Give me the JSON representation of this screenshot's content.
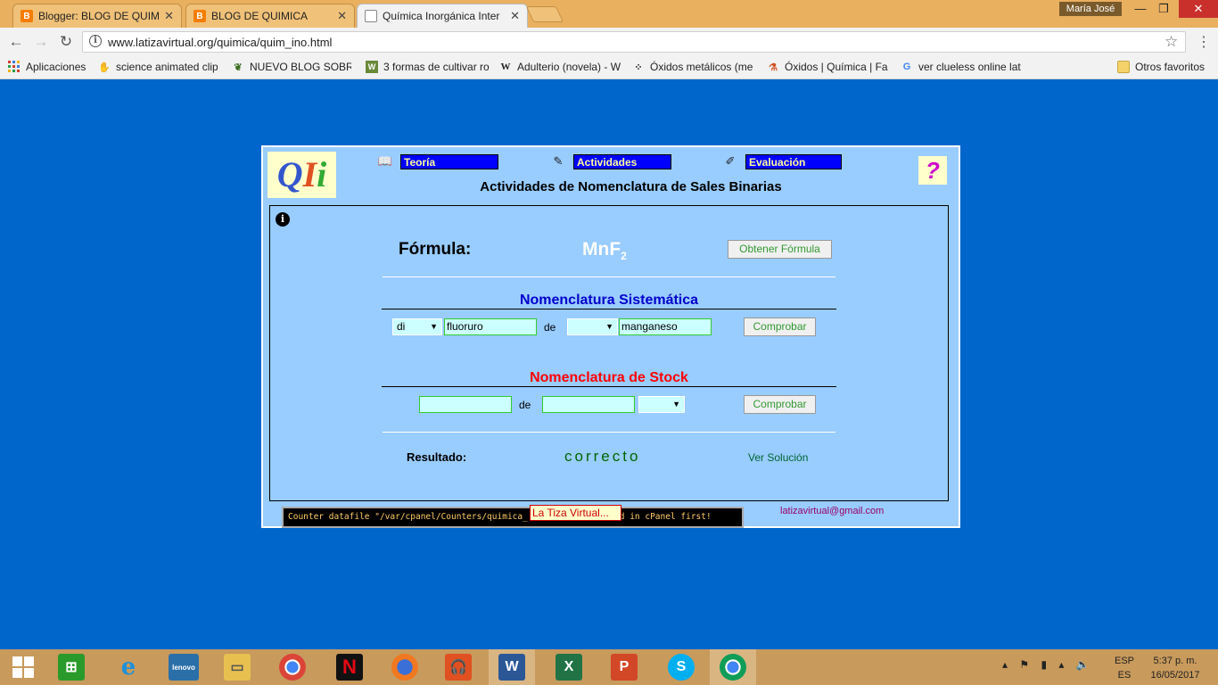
{
  "browser": {
    "tabs": [
      {
        "title": "Blogger: BLOG DE QUIMI",
        "icon": "blogger-icon",
        "active": false
      },
      {
        "title": "BLOG DE QUIMICA",
        "icon": "blogger-icon",
        "active": false
      },
      {
        "title": "Química Inorgánica Inter",
        "icon": "page-icon",
        "active": true
      }
    ],
    "user": "María José",
    "url": "www.latizavirtual.org/quimica/quim_ino.html",
    "bookmarks": [
      {
        "label": "Aplicaciones",
        "icon": "apps-grid-icon"
      },
      {
        "label": "science animated clip",
        "icon": "hands-icon"
      },
      {
        "label": "NUEVO BLOG SOBRE",
        "icon": "leaf-icon"
      },
      {
        "label": "3 formas de cultivar ro",
        "icon": "wikihow-icon"
      },
      {
        "label": "Adulterio (novela) - W",
        "icon": "wikipedia-icon"
      },
      {
        "label": "Óxidos metálicos (me",
        "icon": "molecule-icon"
      },
      {
        "label": "Óxidos | Química | Fa",
        "icon": "flask-icon"
      },
      {
        "label": "ver clueless online lat",
        "icon": "google-icon"
      }
    ],
    "other_bookmarks": "Otros favoritos"
  },
  "page": {
    "logo_text": "QIi",
    "nav": {
      "teoria": "Teoría",
      "actividades": "Actividades",
      "evaluacion": "Evaluación"
    },
    "help_symbol": "?",
    "title": "Actividades de Nomenclatura de Sales Binarias",
    "formula_label": "Fórmula:",
    "formula_main": "MnF",
    "formula_sub": "2",
    "get_formula_button": "Obtener Fórmula",
    "sistematica": {
      "heading": "Nomenclatura Sistemática",
      "prefix1": "di",
      "input1": "fluoruro",
      "connector": "de",
      "prefix2": "",
      "input2": "manganeso",
      "button": "Comprobar"
    },
    "stock": {
      "heading": "Nomenclatura de Stock",
      "input1": "",
      "connector": "de",
      "input2": "",
      "valence": "",
      "button": "Comprobar"
    },
    "result_label": "Resultado:",
    "result_value": "correcto",
    "solution_link": "Ver Solución",
    "email": "latizavirtual@gmail.com",
    "counter_text": "Counter datafile \"/var/cpanel/Counters/quimica_...  must be created in cPanel first!",
    "tooltip": "La Tiza Virtual...",
    "colors": {
      "background": "#0066cc",
      "panel": "#99ccff",
      "nav_box": "#0000ff",
      "stock_heading": "#ff0000",
      "sistematica_heading": "#0000cc"
    }
  },
  "taskbar": {
    "apps": [
      "windows-start-icon",
      "store-icon",
      "internet-explorer-icon",
      "lenovo-icon",
      "file-explorer-icon",
      "chrome-icon",
      "netflix-icon",
      "firefox-icon",
      "music-icon",
      "word-icon",
      "excel-icon",
      "powerpoint-icon",
      "skype-icon",
      "chrome-active-icon"
    ],
    "lang_top": "ESP",
    "lang_bottom": "ES",
    "time": "5:37 p. m.",
    "date": "16/05/2017"
  }
}
